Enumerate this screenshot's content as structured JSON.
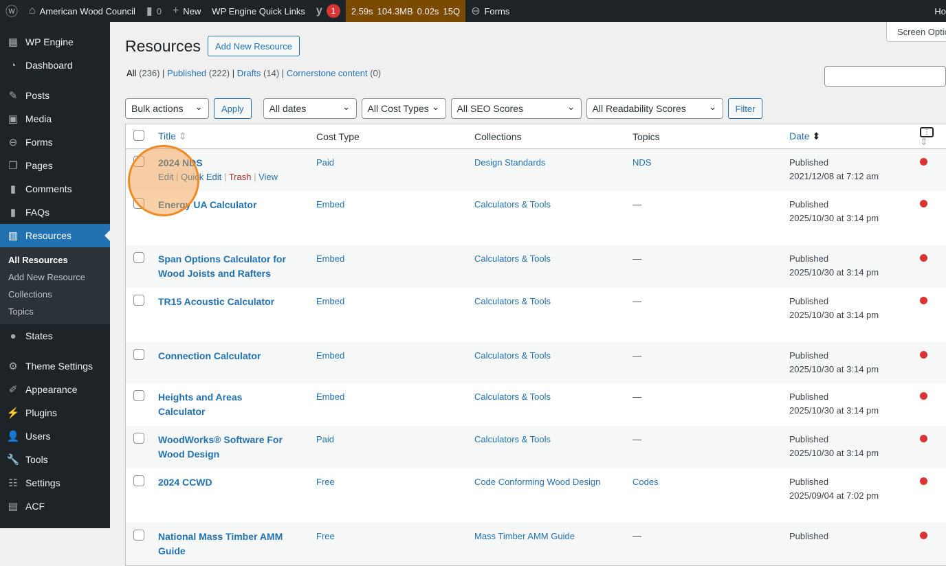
{
  "adminbar": {
    "site": "American Wood Council",
    "comments": "0",
    "new": "New",
    "quicklinks": "WP Engine Quick Links",
    "yoast_count": "1",
    "perf": [
      "2.59s",
      "104.3MB",
      "0.02s",
      "15Q"
    ],
    "forms": "Forms",
    "howdy": "Ho"
  },
  "sidebar": {
    "items": [
      {
        "label": "WP Engine",
        "icon": "grid-icon"
      },
      {
        "label": "Dashboard",
        "icon": "dashboard-icon"
      },
      {
        "label": "Posts",
        "icon": "pin-icon"
      },
      {
        "label": "Media",
        "icon": "media-icon"
      },
      {
        "label": "Forms",
        "icon": "forms-icon"
      },
      {
        "label": "Pages",
        "icon": "pages-icon"
      },
      {
        "label": "Comments",
        "icon": "comment-icon"
      },
      {
        "label": "FAQs",
        "icon": "comment-icon"
      },
      {
        "label": "Resources",
        "icon": "building-icon"
      },
      {
        "label": "States",
        "icon": "globe-icon"
      },
      {
        "label": "Theme Settings",
        "icon": "gear-icon"
      },
      {
        "label": "Appearance",
        "icon": "brush-icon"
      },
      {
        "label": "Plugins",
        "icon": "plug-icon"
      },
      {
        "label": "Users",
        "icon": "user-icon"
      },
      {
        "label": "Tools",
        "icon": "wrench-icon"
      },
      {
        "label": "Settings",
        "icon": "settings-icon"
      },
      {
        "label": "ACF",
        "icon": "acf-icon"
      }
    ],
    "submenu": [
      "All Resources",
      "Add New Resource",
      "Collections",
      "Topics"
    ]
  },
  "page": {
    "title": "Resources",
    "add_new": "Add New Resource",
    "screen_options": "Screen Optio",
    "views": [
      {
        "label": "All",
        "count": "(236)"
      },
      {
        "label": "Published",
        "count": "(222)"
      },
      {
        "label": "Drafts",
        "count": "(14)"
      },
      {
        "label": "Cornerstone content",
        "count": "(0)"
      }
    ],
    "filters": {
      "bulk": "Bulk actions",
      "apply": "Apply",
      "dates": "All dates",
      "cost": "All Cost Types",
      "seo": "All SEO Scores",
      "read": "All Readability Scores",
      "filter": "Filter"
    }
  },
  "table": {
    "headers": {
      "title": "Title",
      "cost": "Cost Type",
      "collections": "Collections",
      "topics": "Topics",
      "date": "Date"
    },
    "row_actions": {
      "edit": "Edit",
      "quick": "Quick Edit",
      "trash": "Trash",
      "view": "View"
    },
    "rows": [
      {
        "title": "2024 NDS",
        "cost": "Paid",
        "collections": "Design Standards",
        "topics": "NDS",
        "status": "Published",
        "date": "2021/12/08 at 7:12 am"
      },
      {
        "title": "Energy UA Calculator",
        "cost": "Embed",
        "collections": "Calculators & Tools",
        "topics": "—",
        "status": "Published",
        "date": "2025/10/30 at 3:14 pm"
      },
      {
        "title": "Span Options Calculator for Wood Joists and Rafters",
        "cost": "Embed",
        "collections": "Calculators & Tools",
        "topics": "—",
        "status": "Published",
        "date": "2025/10/30 at 3:14 pm"
      },
      {
        "title": "TR15 Acoustic Calculator",
        "cost": "Embed",
        "collections": "Calculators & Tools",
        "topics": "—",
        "status": "Published",
        "date": "2025/10/30 at 3:14 pm"
      },
      {
        "title": "Connection Calculator",
        "cost": "Embed",
        "collections": "Calculators & Tools",
        "topics": "—",
        "status": "Published",
        "date": "2025/10/30 at 3:14 pm"
      },
      {
        "title": "Heights and Areas Calculator",
        "cost": "Embed",
        "collections": "Calculators & Tools",
        "topics": "—",
        "status": "Published",
        "date": "2025/10/30 at 3:14 pm"
      },
      {
        "title": "WoodWorks® Software For Wood Design",
        "cost": "Paid",
        "collections": "Calculators & Tools",
        "topics": "—",
        "status": "Published",
        "date": "2025/10/30 at 3:14 pm"
      },
      {
        "title": "2024 CCWD",
        "cost": "Free",
        "collections": "Code Conforming Wood Design",
        "topics": "Codes",
        "status": "Published",
        "date": "2025/09/04 at 7:02 pm"
      },
      {
        "title": "National Mass Timber AMM Guide",
        "cost": "Free",
        "collections": "Mass Timber AMM Guide",
        "topics": "—",
        "status": "Published",
        "date": ""
      }
    ]
  }
}
